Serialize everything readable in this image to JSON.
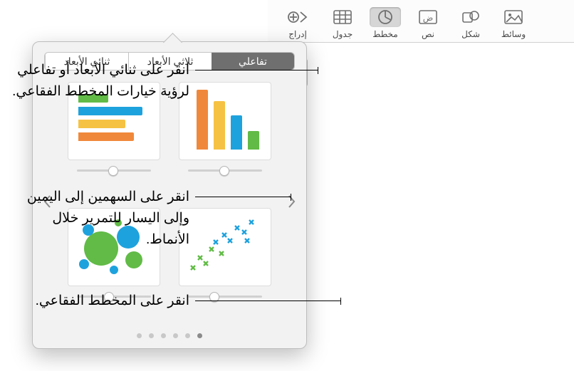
{
  "toolbar": {
    "items": [
      {
        "id": "insert",
        "label": "إدراج"
      },
      {
        "id": "table",
        "label": "جدول"
      },
      {
        "id": "chart",
        "label": "مخطط"
      },
      {
        "id": "text",
        "label": "نص"
      },
      {
        "id": "shape",
        "label": "شكل"
      },
      {
        "id": "media",
        "label": "وسائط"
      }
    ]
  },
  "segments": {
    "two_d": "ثنائي الأبعاد",
    "three_d": "ثلاثي الأبعاد",
    "interactive": "تفاعلي"
  },
  "callouts": {
    "tabs": "انقر على ثنائي الأبعاد أو تفاعلي لرؤية خيارات المخطط الفقاعي.",
    "arrows": "انقر على السهمين إلى اليمين وإلى اليسار للتمرير خلال الأنماط.",
    "bubble": "انقر على المخطط الفقاعي."
  },
  "pager": {
    "count": 6,
    "active": 0
  },
  "colors": {
    "green": "#61bb46",
    "blue": "#1ea2dd",
    "yellow": "#f6c244",
    "orange": "#f0883b"
  }
}
